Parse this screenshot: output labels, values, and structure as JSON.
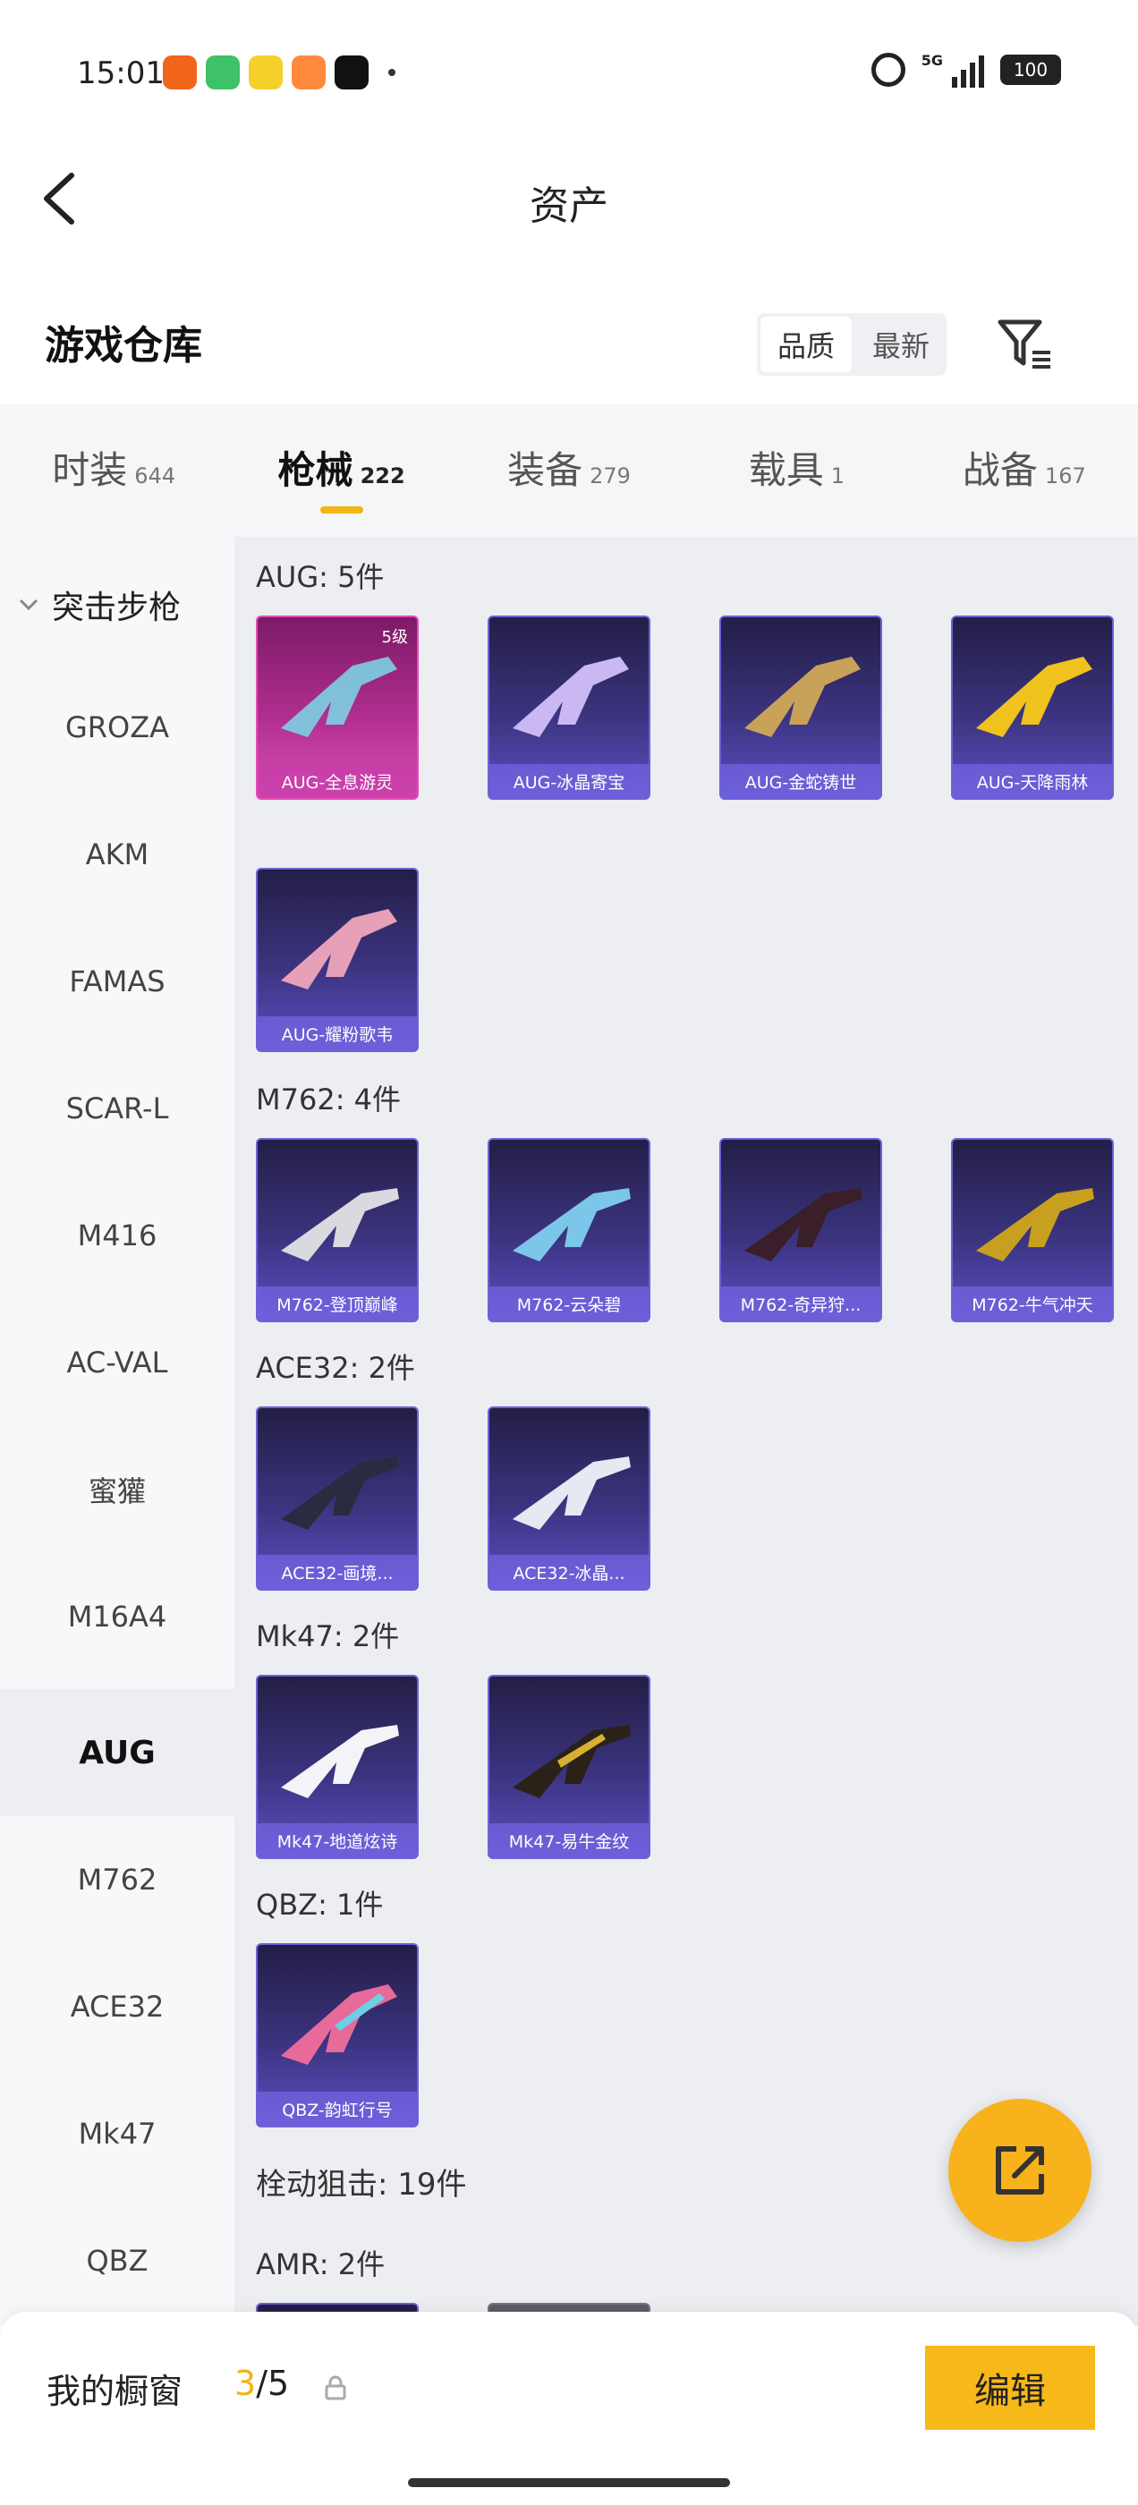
{
  "status_bar": {
    "time": "15:01",
    "network": "5G",
    "battery": "100"
  },
  "header": {
    "title": "资产"
  },
  "warehouse": {
    "title": "游戏仓库",
    "sort_quality": "品质",
    "sort_newest": "最新"
  },
  "tabs": [
    {
      "label": "时装",
      "count": "644"
    },
    {
      "label": "枪械",
      "count": "222"
    },
    {
      "label": "装备",
      "count": "279"
    },
    {
      "label": "载具",
      "count": "1"
    },
    {
      "label": "战备",
      "count": "167"
    }
  ],
  "sidebar": {
    "category": "突击步枪",
    "items": [
      "GROZA",
      "AKM",
      "FAMAS",
      "SCAR-L",
      "M416",
      "AC-VAL",
      "蜜獾",
      "M16A4",
      "AUG",
      "M762",
      "ACE32",
      "Mk47",
      "QBZ"
    ]
  },
  "sections": [
    {
      "title": "AUG: 5件",
      "items": [
        {
          "label": "AUG-全息游灵",
          "level": "5级"
        },
        {
          "label": "AUG-冰晶寄宝"
        },
        {
          "label": "AUG-金蛇铸世"
        },
        {
          "label": "AUG-天降雨林"
        },
        {
          "label": "AUG-耀粉歌韦"
        }
      ]
    },
    {
      "title": "M762: 4件",
      "items": [
        {
          "label": "M762-登顶巅峰"
        },
        {
          "label": "M762-云朵碧"
        },
        {
          "label": "M762-奇异狩..."
        },
        {
          "label": "M762-牛气冲天"
        }
      ]
    },
    {
      "title": "ACE32: 2件",
      "items": [
        {
          "label": "ACE32-画境..."
        },
        {
          "label": "ACE32-冰晶..."
        }
      ]
    },
    {
      "title": "Mk47: 2件",
      "items": [
        {
          "label": "Mk47-地道炫诗"
        },
        {
          "label": "Mk47-易牛金纹"
        }
      ]
    },
    {
      "title": "QBZ: 1件",
      "items": [
        {
          "label": "QBZ-韵虹行号"
        }
      ]
    }
  ],
  "category_bolt": "栓动狙击: 19件",
  "section_amr": "AMR: 2件",
  "bottom_bar": {
    "label": "我的橱窗",
    "count_current": "3",
    "count_total": "/5",
    "edit_label": "编辑"
  },
  "colors": {
    "accent": "#f7b21c",
    "card_purple": "#3c3480",
    "card_legend": "#b12e8f"
  }
}
